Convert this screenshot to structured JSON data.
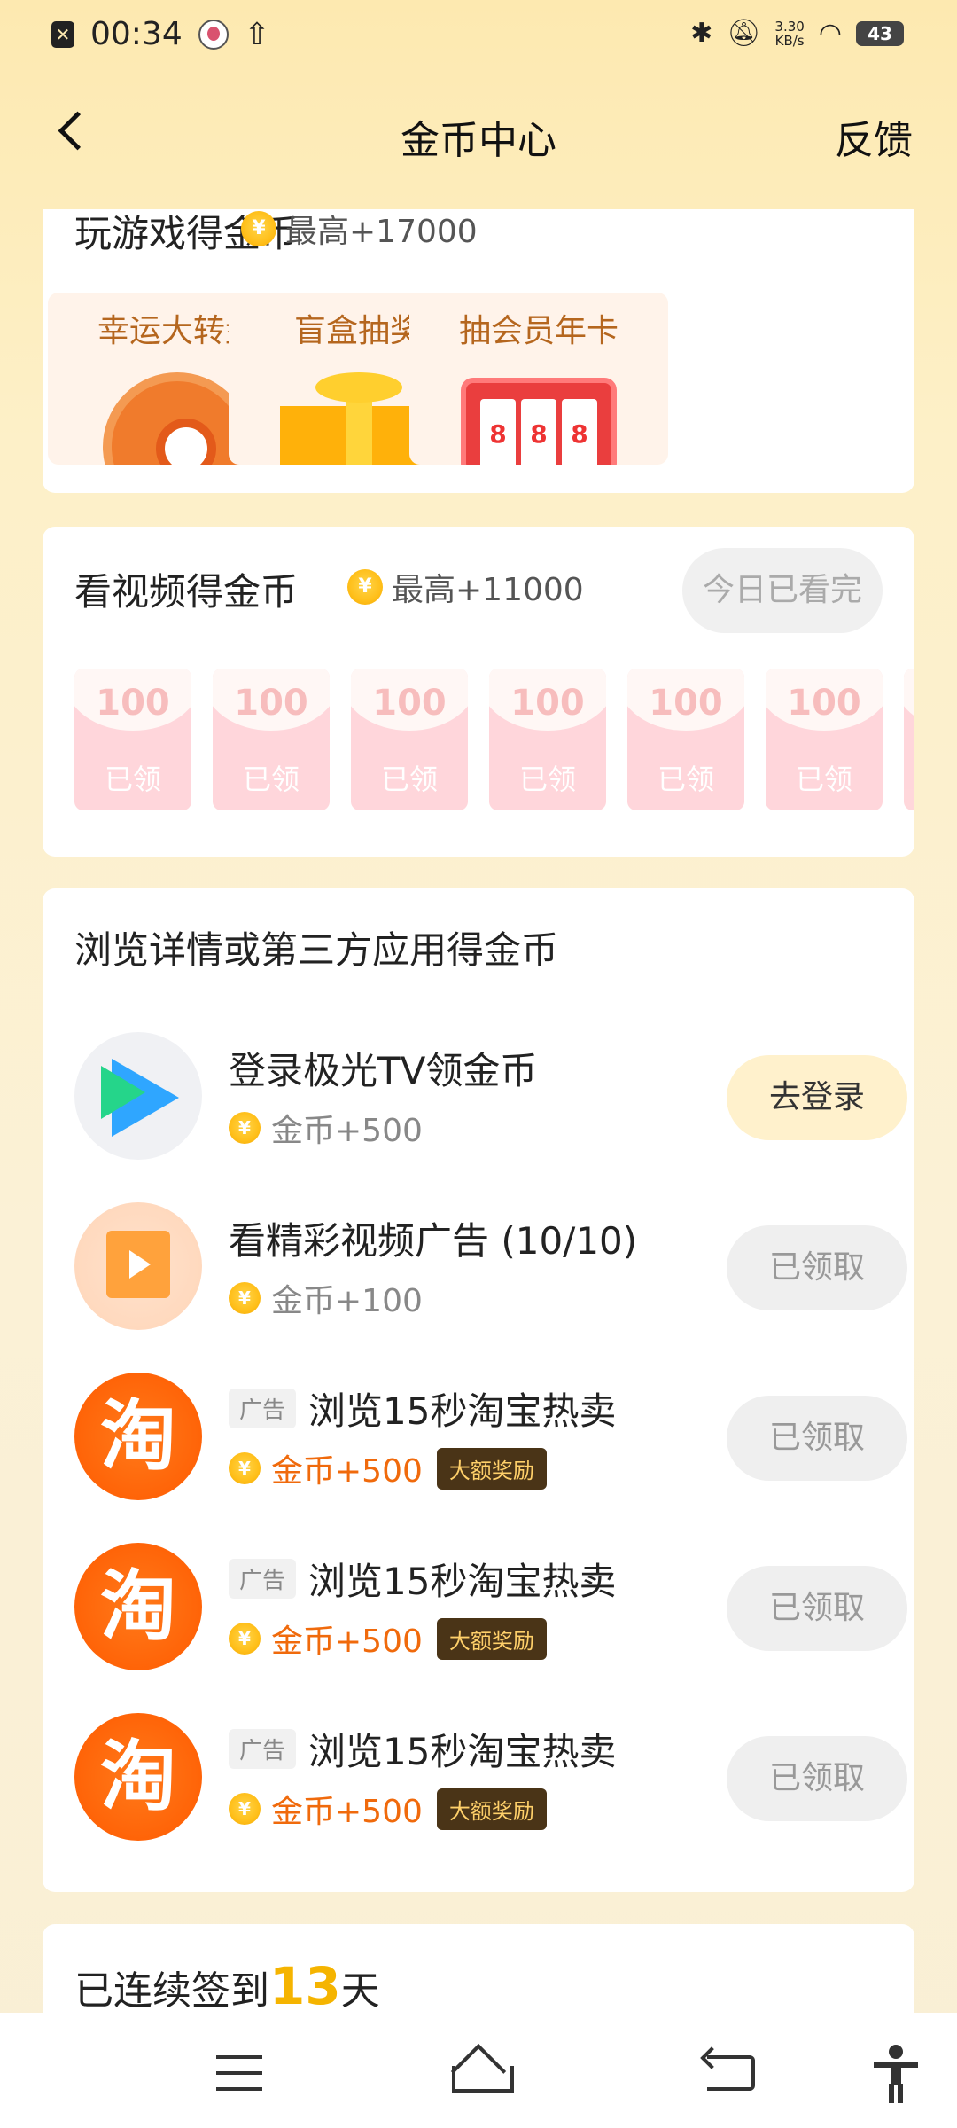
{
  "status_bar": {
    "time": "00:34",
    "speed_value": "3.30",
    "speed_unit": "KB/s",
    "battery": "43"
  },
  "nav": {
    "title": "金币中心",
    "feedback": "反馈"
  },
  "games": {
    "title": "玩游戏得金币",
    "max": "最高+17000",
    "tiles": [
      {
        "label": "幸运大转盘"
      },
      {
        "label": "盲盒抽奖"
      },
      {
        "label": "抽会员年卡",
        "slot": [
          "8",
          "8",
          "8"
        ]
      }
    ]
  },
  "video": {
    "title": "看视频得金币",
    "max": "最高+11000",
    "done_label": "今日已看完",
    "packets": [
      {
        "amount": "100",
        "label": "已领"
      },
      {
        "amount": "100",
        "label": "已领"
      },
      {
        "amount": "100",
        "label": "已领"
      },
      {
        "amount": "100",
        "label": "已领"
      },
      {
        "amount": "100",
        "label": "已领"
      },
      {
        "amount": "100",
        "label": "已领"
      }
    ]
  },
  "browse": {
    "title": "浏览详情或第三方应用得金币",
    "tasks": [
      {
        "title": "登录极光TV领金币",
        "reward": "金币+500",
        "button": "去登录"
      },
      {
        "title": "看精彩视频广告 (10/10)",
        "reward": "金币+100",
        "button": "已领取"
      },
      {
        "ad": "广告",
        "title": "浏览15秒淘宝热卖",
        "reward": "金币+500",
        "tag": "大额奖励",
        "button": "已领取",
        "icon_char": "淘"
      },
      {
        "ad": "广告",
        "title": "浏览15秒淘宝热卖",
        "reward": "金币+500",
        "tag": "大额奖励",
        "button": "已领取",
        "icon_char": "淘"
      },
      {
        "ad": "广告",
        "title": "浏览15秒淘宝热卖",
        "reward": "金币+500",
        "tag": "大额奖励",
        "button": "已领取",
        "icon_char": "淘"
      }
    ]
  },
  "signin": {
    "prefix": "已连续签到",
    "days": "13",
    "suffix": "天"
  },
  "coin_symbol": "¥"
}
